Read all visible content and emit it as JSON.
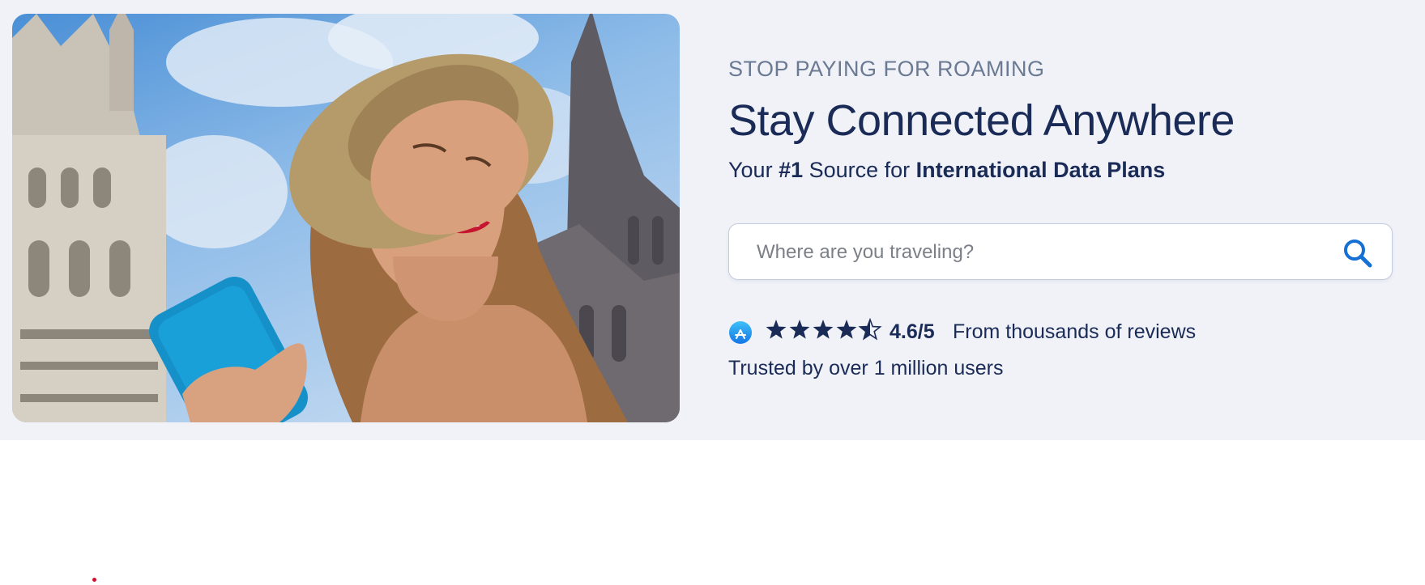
{
  "hero": {
    "image_alt": "Smiling woman in straw hat holding a blue phone in front of gothic buildings",
    "eyebrow": "STOP PAYING FOR ROAMING",
    "headline": "Stay Connected Anywhere",
    "subline": {
      "part1": "Your ",
      "highlight1": "#1",
      "part2": " Source for ",
      "highlight2": "International Data Plans"
    },
    "search": {
      "placeholder": "Where are you traveling?",
      "value": ""
    },
    "rating": {
      "icon": "app-store-icon",
      "stars": 4.5,
      "max_stars": 5,
      "score_label": "4.6/5",
      "text": "From thousands of reviews"
    },
    "trusted_text": "Trusted by over 1 million users"
  },
  "colors": {
    "hero_background": "#f0f2f7",
    "heading": "#1a2b57",
    "eyebrow": "#6b7a93",
    "search_icon": "#1670d4",
    "accent_dot": "#d0112b"
  }
}
